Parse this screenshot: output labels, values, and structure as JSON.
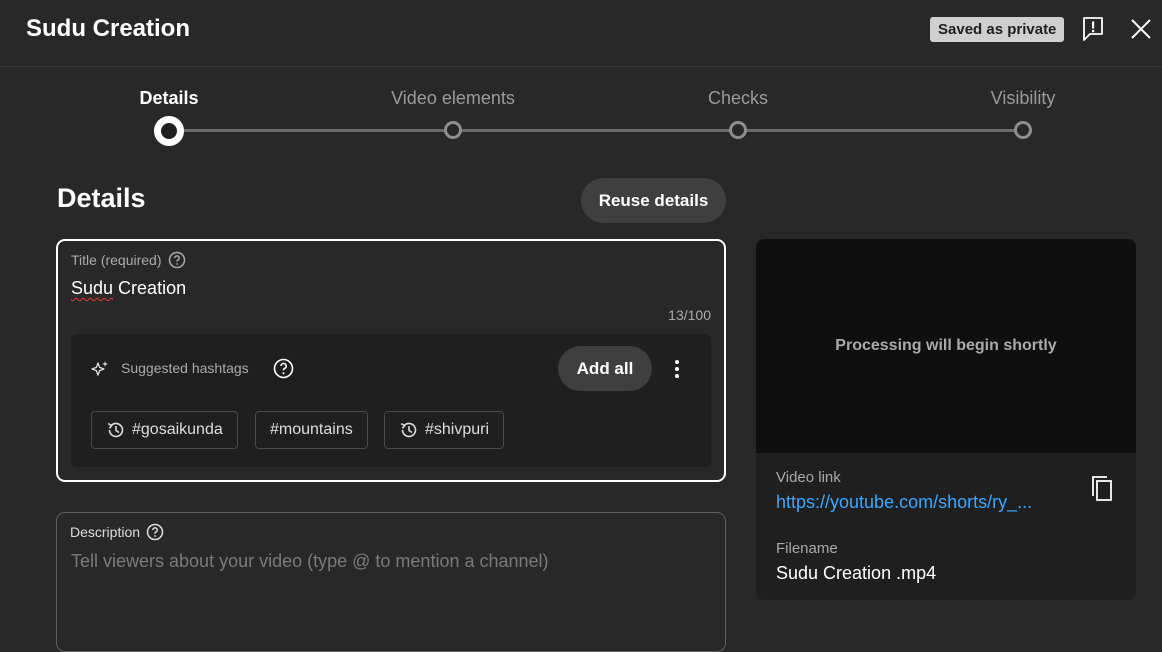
{
  "header": {
    "title": "Sudu Creation",
    "saved_badge": "Saved as private",
    "feedback_icon": "feedback-icon",
    "close_icon": "close-icon"
  },
  "stepper": {
    "steps": [
      {
        "label": "Details",
        "active": true
      },
      {
        "label": "Video elements",
        "active": false
      },
      {
        "label": "Checks",
        "active": false
      },
      {
        "label": "Visibility",
        "active": false
      }
    ]
  },
  "details": {
    "heading": "Details",
    "reuse_button": "Reuse details",
    "title_field": {
      "label": "Title (required)",
      "value": "Sudu Creation",
      "value_first_word": "Sudu",
      "value_rest": " Creation",
      "count": "13/100"
    },
    "hashtags": {
      "label": "Suggested hashtags",
      "add_all": "Add all",
      "chips": [
        {
          "text": "#gosaikunda",
          "history": true
        },
        {
          "text": "#mountains",
          "history": false
        },
        {
          "text": "#shivpuri",
          "history": true
        }
      ]
    },
    "description": {
      "label": "Description",
      "placeholder": "Tell viewers about your video (type @ to mention a channel)"
    }
  },
  "preview": {
    "processing_text": "Processing will begin shortly",
    "video_link_label": "Video link",
    "video_link": "https://youtube.com/shorts/ry_...",
    "filename_label": "Filename",
    "filename": "Sudu Creation .mp4"
  },
  "colors": {
    "background": "#282828",
    "link": "#3ea6ff",
    "spellcheck": "#e53935"
  }
}
